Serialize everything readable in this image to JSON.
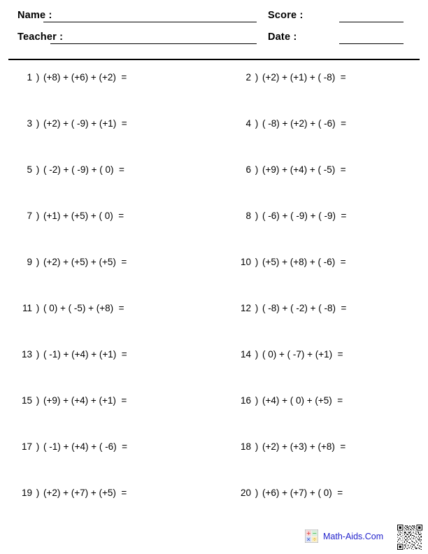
{
  "header": {
    "name_label": "Name :",
    "teacher_label": "Teacher :",
    "score_label": "Score :",
    "date_label": "Date :",
    "name_value": "",
    "teacher_value": "",
    "score_value": "",
    "date_value": ""
  },
  "problems": [
    {
      "number": "1",
      "paren": ")",
      "expression": "(+8) + (+6) + (+2)  ="
    },
    {
      "number": "2",
      "paren": ")",
      "expression": "(+2) + (+1) + ( -8)  ="
    },
    {
      "number": "3",
      "paren": ")",
      "expression": "(+2) + ( -9) + (+1)  ="
    },
    {
      "number": "4",
      "paren": ")",
      "expression": "( -8) + (+2) + ( -6)  ="
    },
    {
      "number": "5",
      "paren": ")",
      "expression": "( -2) + ( -9) + ( 0)  ="
    },
    {
      "number": "6",
      "paren": ")",
      "expression": "(+9) + (+4) + ( -5)  ="
    },
    {
      "number": "7",
      "paren": ")",
      "expression": "(+1) + (+5) + ( 0)  ="
    },
    {
      "number": "8",
      "paren": ")",
      "expression": "( -6) + ( -9) + ( -9)  ="
    },
    {
      "number": "9",
      "paren": ")",
      "expression": "(+2) + (+5) + (+5)  ="
    },
    {
      "number": "10",
      "paren": ")",
      "expression": "(+5) + (+8) + ( -6)  ="
    },
    {
      "number": "11",
      "paren": ")",
      "expression": "( 0) + ( -5) + (+8)  ="
    },
    {
      "number": "12",
      "paren": ")",
      "expression": "( -8) + ( -2) + ( -8)  ="
    },
    {
      "number": "13",
      "paren": ")",
      "expression": "( -1) + (+4) + (+1)  ="
    },
    {
      "number": "14",
      "paren": ")",
      "expression": "( 0) + ( -7) + (+1)  ="
    },
    {
      "number": "15",
      "paren": ")",
      "expression": "(+9) + (+4) + (+1)  ="
    },
    {
      "number": "16",
      "paren": ")",
      "expression": "(+4) + ( 0) + (+5)  ="
    },
    {
      "number": "17",
      "paren": ")",
      "expression": "( -1) + (+4) + ( -6)  ="
    },
    {
      "number": "18",
      "paren": ")",
      "expression": "(+2) + (+3) + (+8)  ="
    },
    {
      "number": "19",
      "paren": ")",
      "expression": "(+2) + (+7) + (+5)  ="
    },
    {
      "number": "20",
      "paren": ")",
      "expression": "(+6) + (+7) + ( 0)  ="
    }
  ],
  "footer": {
    "brand_text": "Math-Aids.Com",
    "brand_color": "#2222cc",
    "brand_icon": "math-operations-icon",
    "qr_icon": "qr-code-icon",
    "icon_symbols": {
      "plus": "+",
      "minus": "−",
      "times": "×",
      "divide": "÷"
    },
    "icon_colors": {
      "plus": "#dd2222",
      "minus": "#22aa33",
      "times": "#2244cc",
      "divide": "#ddaa11"
    }
  }
}
